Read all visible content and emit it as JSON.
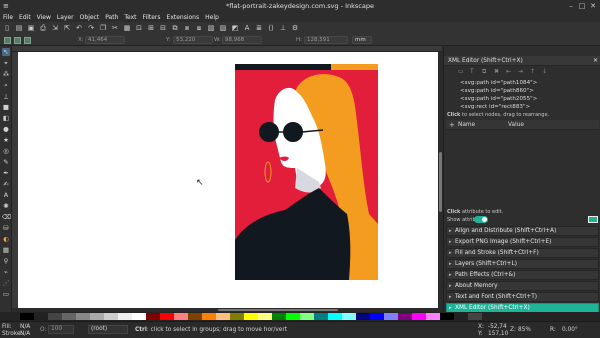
{
  "window": {
    "title": "*flat-portrait-zakeydesign.com.svg - Inkscape"
  },
  "menu": [
    "File",
    "Edit",
    "View",
    "Layer",
    "Object",
    "Path",
    "Text",
    "Filters",
    "Extensions",
    "Help"
  ],
  "tool_controls": {
    "x_label": "X:",
    "x_value": "41,464",
    "y_label": "Y:",
    "y_value": "53,220",
    "w_label": "W:",
    "w_value": "98,968",
    "h_label": "H:",
    "h_value": "128,591",
    "units": "mm"
  },
  "xml_editor": {
    "title": "XML Editor (Shift+Ctrl+X)",
    "nodes": [
      "<svg:path id=\"path1084\">",
      "<svg:path id=\"path860\">",
      "<svg:path id=\"path2055\">",
      "<svg:rect id=\"rect883\">"
    ],
    "hint_bold": "Click",
    "hint_rest": "to select nodes, drag to rearrange.",
    "col_name": "Name",
    "col_value": "Value",
    "attr_hint_bold": "Click",
    "attr_hint_rest": "attribute to edit.",
    "show_attributes": "Show attributes"
  },
  "panels": [
    {
      "label": "Align and Distribute (Shift+Ctrl+A)"
    },
    {
      "label": "Export PNG Image (Shift+Ctrl+E)"
    },
    {
      "label": "Fill and Stroke (Shift+Ctrl+F)"
    },
    {
      "label": "Layers (Shift+Ctrl+L)"
    },
    {
      "label": "Path Effects (Ctrl+&)"
    },
    {
      "label": "About Memory"
    },
    {
      "label": "Text and Font (Shift+Ctrl+T)"
    },
    {
      "label": "XML Editor (Shift+Ctrl+X)"
    }
  ],
  "status": {
    "fill_label": "Fill:",
    "fill_value": "N/A",
    "stroke_label": "Stroke:",
    "stroke_value": "N/A",
    "opacity_label": "O:",
    "opacity_value": "100",
    "layer": "(root)",
    "message_bold": "Ctrl",
    "message_rest": ": click to select in groups; drag to move hor/vert",
    "x_label": "X:",
    "x_value": "-52,74",
    "y_label": "Y:",
    "y_value": "157,10",
    "z_label": "Z:",
    "zoom": "85%",
    "r_label": "R:",
    "rotation": "0,00°"
  },
  "colors": {
    "accent": "#1fb398",
    "art_background": "#e21e3a",
    "hair": "#f39c1f",
    "skin": "#ffffff",
    "clothing": "#101921",
    "lips": "#e21e3a"
  }
}
